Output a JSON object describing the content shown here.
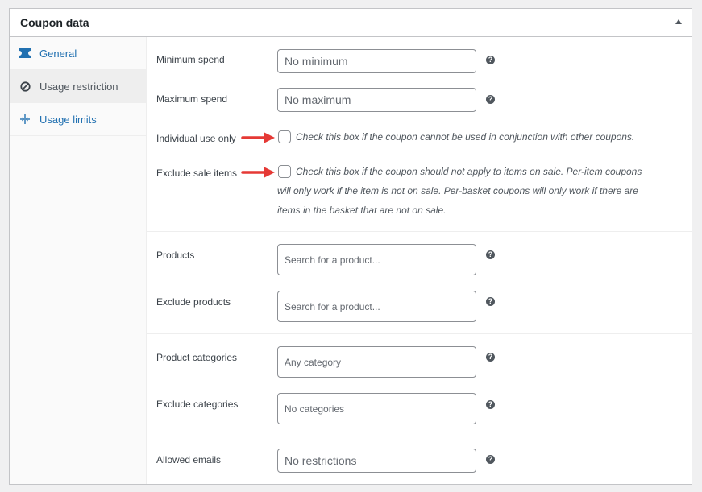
{
  "header": {
    "title": "Coupon data"
  },
  "tabs": [
    {
      "label": "General",
      "icon": "ticket-icon"
    },
    {
      "label": "Usage restriction",
      "icon": "prohibited-icon"
    },
    {
      "label": "Usage limits",
      "icon": "limits-icon"
    }
  ],
  "fields": {
    "minimum_spend": {
      "label": "Minimum spend",
      "placeholder": "No minimum"
    },
    "maximum_spend": {
      "label": "Maximum spend",
      "placeholder": "No maximum"
    },
    "individual_use": {
      "label": "Individual use only",
      "description": "Check this box if the coupon cannot be used in conjunction with other coupons."
    },
    "exclude_sale": {
      "label": "Exclude sale items",
      "description_lines": [
        "Check this box if the coupon should not apply to items on sale. Per-item coupons",
        "will only work if the item is not on sale. Per-basket coupons will only work if there are",
        "items in the basket that are not on sale."
      ]
    },
    "products": {
      "label": "Products",
      "placeholder": "Search for a product..."
    },
    "exclude_products": {
      "label": "Exclude products",
      "placeholder": "Search for a product..."
    },
    "product_categories": {
      "label": "Product categories",
      "placeholder": "Any category"
    },
    "exclude_categories": {
      "label": "Exclude categories",
      "placeholder": "No categories"
    },
    "allowed_emails": {
      "label": "Allowed emails",
      "placeholder": "No restrictions"
    }
  },
  "help_glyph": "?",
  "colors": {
    "accent": "#2271b1",
    "arrow": "#e53935",
    "border": "#c3c4c7"
  }
}
